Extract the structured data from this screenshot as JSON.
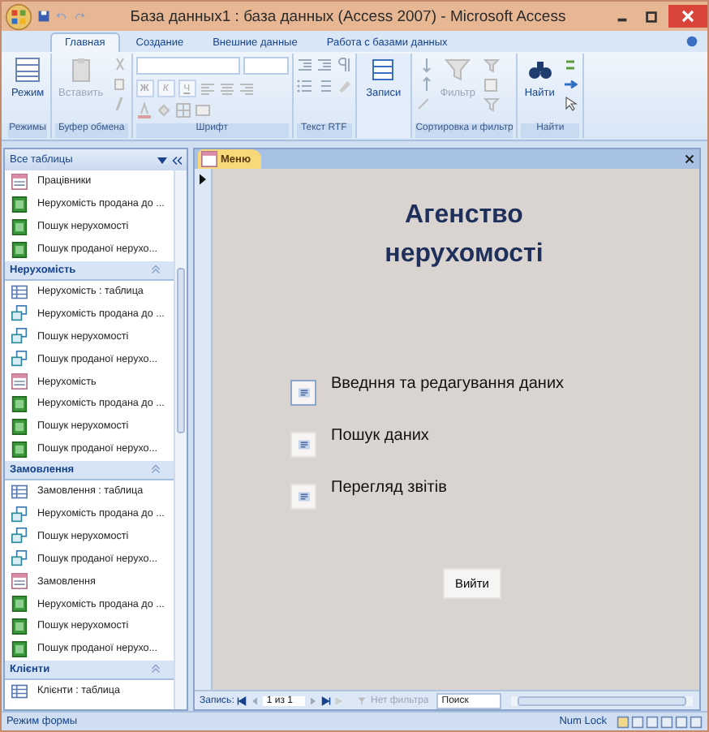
{
  "window": {
    "title": "База данных1 : база данных (Access 2007) - Microsoft Access"
  },
  "tabs": [
    {
      "label": "Главная",
      "selected": true
    },
    {
      "label": "Создание",
      "selected": false
    },
    {
      "label": "Внешние данные",
      "selected": false
    },
    {
      "label": "Работа с базами данных",
      "selected": false
    }
  ],
  "ribbon": {
    "groups": [
      {
        "label": "Режимы",
        "kind": "view",
        "commands": [
          {
            "label": "Режим",
            "disabled": false
          }
        ]
      },
      {
        "label": "Буфер обмена",
        "kind": "clipboard",
        "commands": [
          {
            "label": "Вставить",
            "disabled": true
          }
        ]
      },
      {
        "label": "Шрифт",
        "kind": "font",
        "commands": [
          {
            "label": "Ж",
            "disabled": true
          },
          {
            "label": "К",
            "disabled": true
          },
          {
            "label": "Ч",
            "disabled": true
          }
        ]
      },
      {
        "label": "Текст RTF",
        "kind": "rtf"
      },
      {
        "kind": "records",
        "commands": [
          {
            "label": "Записи",
            "disabled": false
          }
        ]
      },
      {
        "label": "Сортировка и фильтр",
        "kind": "sort",
        "commands": [
          {
            "label": "Фильтр",
            "disabled": true
          }
        ]
      },
      {
        "label": "Найти",
        "kind": "find",
        "commands": [
          {
            "label": "Найти",
            "disabled": false
          }
        ]
      }
    ]
  },
  "nav_pane": {
    "title": "Все таблицы",
    "sections": [
      {
        "items": [
          {
            "label": "Працівники",
            "kind": "form"
          },
          {
            "label": "Нерухомість продана до ...",
            "kind": "report"
          },
          {
            "label": "Пошук нерухомості",
            "kind": "report"
          },
          {
            "label": "Пошук проданої нерухо...",
            "kind": "report"
          }
        ]
      },
      {
        "title": "Нерухомість",
        "items": [
          {
            "label": "Нерухомість : таблица",
            "kind": "table"
          },
          {
            "label": "Нерухомість продана до ...",
            "kind": "query"
          },
          {
            "label": "Пошук нерухомості",
            "kind": "query"
          },
          {
            "label": "Пошук проданої нерухо...",
            "kind": "query"
          },
          {
            "label": "Нерухомість",
            "kind": "form"
          },
          {
            "label": "Нерухомість продана до ...",
            "kind": "report"
          },
          {
            "label": "Пошук нерухомості",
            "kind": "report"
          },
          {
            "label": "Пошук проданої нерухо...",
            "kind": "report"
          }
        ]
      },
      {
        "title": "Замовлення",
        "items": [
          {
            "label": "Замовлення : таблица",
            "kind": "table"
          },
          {
            "label": "Нерухомість продана до ...",
            "kind": "query"
          },
          {
            "label": "Пошук нерухомості",
            "kind": "query"
          },
          {
            "label": "Пошук проданої нерухо...",
            "kind": "query"
          },
          {
            "label": "Замовлення",
            "kind": "form"
          },
          {
            "label": "Нерухомість продана до ...",
            "kind": "report"
          },
          {
            "label": "Пошук нерухомості",
            "kind": "report"
          },
          {
            "label": "Пошук проданої нерухо...",
            "kind": "report"
          }
        ]
      },
      {
        "title": "Клієнти",
        "items": [
          {
            "label": "Клієнти : таблица",
            "kind": "table"
          }
        ]
      }
    ]
  },
  "document_tabs": [
    {
      "label": "Меню",
      "selected": true
    }
  ],
  "form": {
    "title_lines": [
      "Агенство",
      "нерухомості"
    ],
    "menu_buttons": [
      {
        "label": "Введння та редагування даних",
        "focused": true
      },
      {
        "label": "Пошук даних",
        "focused": false
      },
      {
        "label": "Перегляд звітів",
        "focused": false
      }
    ],
    "exit_button": "Вийти"
  },
  "record_nav": {
    "label": "Запись:",
    "position": "1 из 1",
    "filter": "Нет фильтра",
    "search_placeholder": "Поиск"
  },
  "status_bar": {
    "mode": "Режим формы",
    "indicators": [
      "Num Lock"
    ]
  }
}
